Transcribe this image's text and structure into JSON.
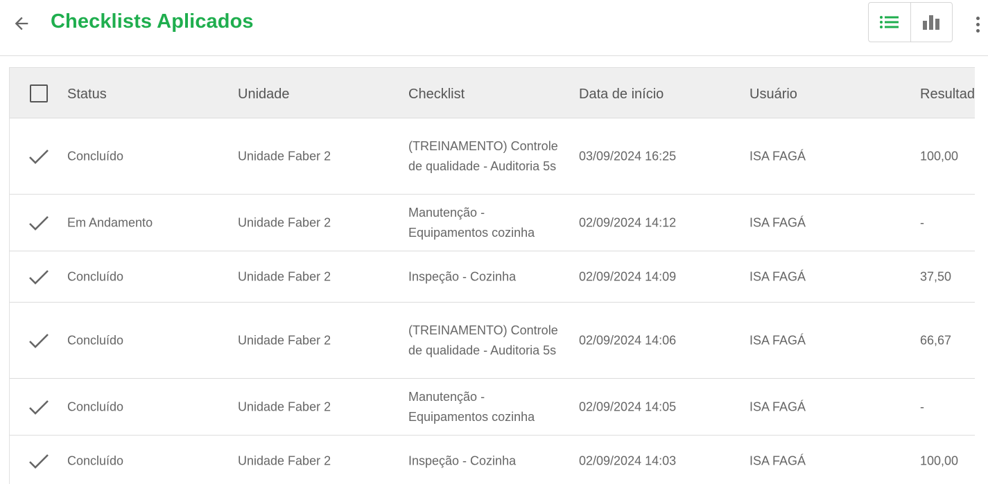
{
  "header": {
    "title": "Checklists Aplicados"
  },
  "table": {
    "columns": [
      "Status",
      "Unidade",
      "Checklist",
      "Data de início",
      "Usuário",
      "Resultado"
    ],
    "rows": [
      {
        "status": "Concluído",
        "unidade": "Unidade Faber 2",
        "checklist": "(TREINAMENTO) Controle de qualidade -  Auditoria 5s",
        "data": "03/09/2024 16:25",
        "usuario": "ISA FAGÁ",
        "resultado": "100,00"
      },
      {
        "status": "Em Andamento",
        "unidade": "Unidade Faber 2",
        "checklist": "Manutenção - Equipamentos cozinha",
        "data": "02/09/2024 14:12",
        "usuario": "ISA FAGÁ",
        "resultado": "-"
      },
      {
        "status": "Concluído",
        "unidade": "Unidade Faber 2",
        "checklist": "Inspeção - Cozinha",
        "data": "02/09/2024 14:09",
        "usuario": "ISA FAGÁ",
        "resultado": "37,50"
      },
      {
        "status": "Concluído",
        "unidade": "Unidade Faber 2",
        "checklist": "(TREINAMENTO) Controle de qualidade -  Auditoria 5s",
        "data": "02/09/2024 14:06",
        "usuario": "ISA FAGÁ",
        "resultado": "66,67"
      },
      {
        "status": "Concluído",
        "unidade": "Unidade Faber 2",
        "checklist": "Manutenção - Equipamentos cozinha",
        "data": "02/09/2024 14:05",
        "usuario": "ISA FAGÁ",
        "resultado": "-"
      },
      {
        "status": "Concluído",
        "unidade": "Unidade Faber 2",
        "checklist": "Inspeção - Cozinha",
        "data": "02/09/2024 14:03",
        "usuario": "ISA FAGÁ",
        "resultado": "100,00"
      }
    ]
  },
  "colors": {
    "accent": "#1fae4e",
    "header_bg": "#efefef"
  },
  "icons": {
    "back": "arrow-left-icon",
    "list_view": "list-icon",
    "chart_view": "bar-chart-icon",
    "more": "more-vert-icon",
    "status": "check-icon"
  }
}
